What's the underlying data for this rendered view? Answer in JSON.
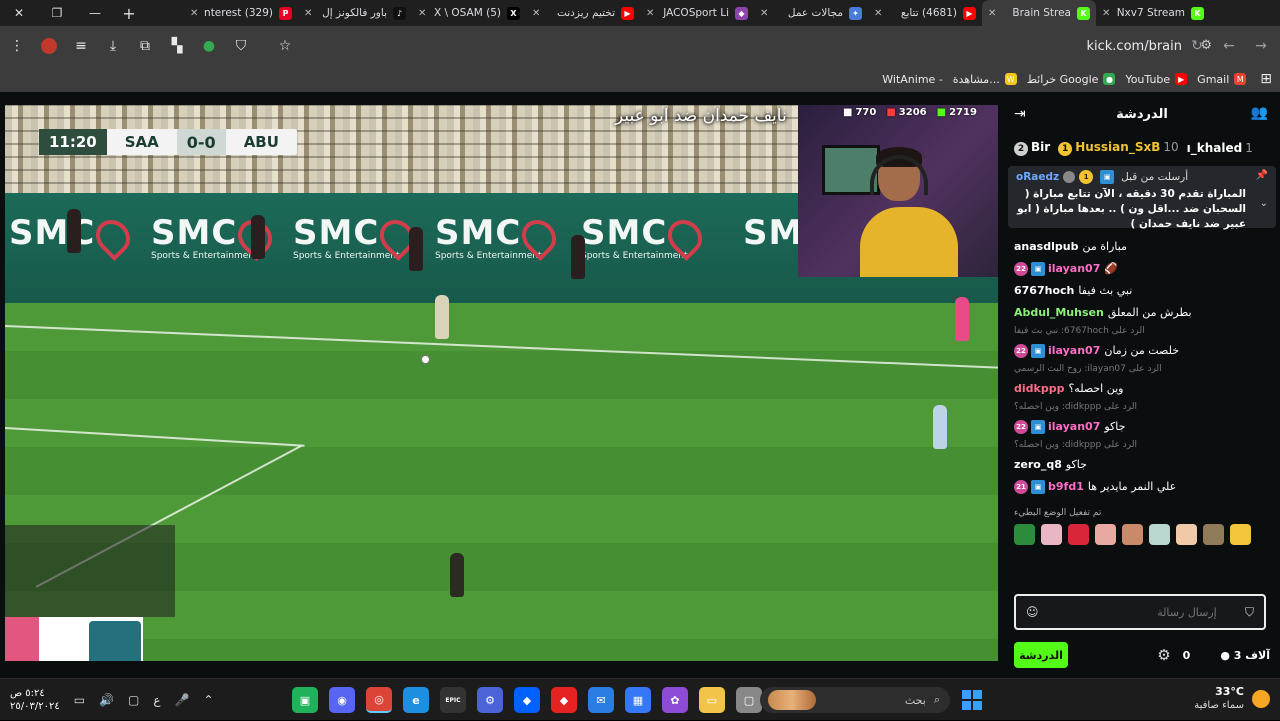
{
  "browser": {
    "window_controls": {
      "close": "✕",
      "restore": "❐",
      "minimize": "—"
    },
    "new_tab_label": "+",
    "tabs": [
      {
        "title": "(329) Pinterest",
        "icon": "pinterest-icon",
        "color": "#e60023",
        "glyph": "P",
        "active": false
      },
      {
        "title": "باور فالكونز إل",
        "icon": "tiktok-icon",
        "color": "#111111",
        "glyph": "♪",
        "active": false
      },
      {
        "title": "(5) X \\ OSAM",
        "icon": "x-icon",
        "color": "#000000",
        "glyph": "X",
        "active": false
      },
      {
        "title": "تختيم ريزدنت",
        "icon": "youtube-icon",
        "color": "#ff0000",
        "glyph": "▶",
        "active": false
      },
      {
        "title": "JACOSport Li",
        "icon": "kick-icon-purple",
        "color": "#8e44ad",
        "glyph": "◆",
        "active": false
      },
      {
        "title": "مجالات عمل",
        "icon": "gemini-icon",
        "color": "#4a7bd9",
        "glyph": "✦",
        "active": false
      },
      {
        "title": "(4681) تتابع",
        "icon": "youtube-icon",
        "color": "#ff0000",
        "glyph": "▶",
        "active": false
      },
      {
        "title": "Brain Strea",
        "icon": "kick-icon",
        "color": "#53fc18",
        "glyph": "K",
        "active": true
      },
      {
        "title": "Nxv7 Stream",
        "icon": "kick-icon",
        "color": "#53fc18",
        "glyph": "K",
        "active": false
      }
    ],
    "address": "kick.com/brain",
    "bookmarks": [
      {
        "label": "Gmail",
        "icon": "gmail-icon",
        "color": "#ea4335",
        "glyph": "M"
      },
      {
        "label": "YouTube",
        "icon": "youtube-icon",
        "color": "#ff0000",
        "glyph": "▶"
      },
      {
        "label": "خرائط Google",
        "icon": "maps-icon",
        "color": "#34a853",
        "glyph": "●"
      },
      {
        "label": "مشاهدة...",
        "icon": "witanime-icon",
        "color": "#f5c518",
        "glyph": "W"
      },
      {
        "label": "WitAnime -",
        "icon": "",
        "color": "",
        "glyph": ""
      }
    ]
  },
  "video": {
    "banner": "نايف حمدان ضد ابو عبير",
    "scoreboard": {
      "time": "11:20",
      "home": "SAA",
      "score": "0-0",
      "away": "ABU"
    },
    "sponsor": "SMC",
    "sponsor_sub": "Sports & Entertainment",
    "counters": [
      {
        "value": "770",
        "icon": "viewer-icon"
      },
      {
        "value": "3206",
        "icon": "youtube-icon"
      },
      {
        "value": "2719",
        "icon": "kick-icon"
      }
    ]
  },
  "chat": {
    "title": "الدردشة",
    "gifters": [
      {
        "name": "Bir",
        "rank": "2",
        "medal_color": "#cfcfcf",
        "count": ""
      },
      {
        "name": "Hussian_SxB",
        "rank": "1",
        "medal_color": "#f1c232",
        "count": "10"
      },
      {
        "name": "ı_khaled",
        "rank": "",
        "medal_color": "",
        "count": "1"
      }
    ],
    "pinned": {
      "user": "oRaedz",
      "label": "أرسلت من قبل",
      "text": "المباراة تقدم 30 دقيقه ، الآن تتابع مباراة ( السحبان ضد ...اقل ون ) .. بعدها مباراة ( ابو عبير ضد نايف حمدان )"
    },
    "messages": [
      {
        "user": "anasdlpub",
        "color": "#ffffff",
        "text": "مباراة من",
        "badges": []
      },
      {
        "user": "ilayan07",
        "color": "#ff6ec7",
        "text": "🏈",
        "badges": [
          "22"
        ]
      },
      {
        "user": "6767hoch",
        "color": "#ffffff",
        "text": "نبي بث فيفا",
        "badges": []
      },
      {
        "user": "Abdul_Muhsen",
        "color": "#8df07a",
        "text": "بطرش من المعلق",
        "badges": []
      },
      {
        "reply": "الرد على 6767hoch: نبي بث فيفا"
      },
      {
        "user": "ilayan07",
        "color": "#ff6ec7",
        "text": "خلصت من زمان",
        "badges": [
          "22"
        ]
      },
      {
        "reply": "الرد على ilayan07: روح البث الرسمي"
      },
      {
        "user": "didkppp",
        "color": "#ff6b8a",
        "text": "وين احصله؟",
        "badges": []
      },
      {
        "reply": "الرد على didkppp: وين احصله؟"
      },
      {
        "user": "ilayan07",
        "color": "#ff6ec7",
        "text": "جاكو",
        "badges": [
          "22"
        ]
      },
      {
        "reply": "الرد على didkppp: وين احصله؟"
      },
      {
        "user": "zero_q8",
        "color": "#ffffff",
        "text": "جاكو",
        "badges": []
      },
      {
        "user": "b9fd1",
        "color": "#ff6ec7",
        "text": "علي النمر مايدير ها",
        "badges": [
          "21"
        ]
      }
    ],
    "emote_note": "تم تفعيل الوضع البطيء",
    "emote_colors": [
      "#2d8c3c",
      "#e9b7c4",
      "#d9263a",
      "#e7a9a0",
      "#c98a6a",
      "#b9d6cf",
      "#f0c9a8",
      "#8f7a5a",
      "#f3c53a"
    ],
    "input_placeholder": "إرسال رسالة",
    "followers": "0",
    "viewers": "3 آلاف",
    "send_label": "الدردشة"
  },
  "taskbar": {
    "temperature": "33°C",
    "weather_text": "سماء صافية",
    "search_label": "بحث",
    "time": "٥:٢٤ ص",
    "date": "٢٥/٠٣/٢٠٢٤",
    "lang": "ع",
    "apps": [
      {
        "name": "task-view-app",
        "color": "#1fb25a",
        "glyph": "▣"
      },
      {
        "name": "discord-app",
        "color": "#5865f2",
        "glyph": "◉"
      },
      {
        "name": "chrome-app",
        "color": "#db4437",
        "glyph": "◎"
      },
      {
        "name": "edge-app",
        "color": "#1d8fe0",
        "glyph": "e"
      },
      {
        "name": "epic-games-app",
        "color": "#333333",
        "glyph": "EPIC"
      },
      {
        "name": "settings-app",
        "color": "#4b63d6",
        "glyph": "⚙"
      },
      {
        "name": "dropbox-app",
        "color": "#0061ff",
        "glyph": "◆"
      },
      {
        "name": "red-app",
        "color": "#e62222",
        "glyph": "◆"
      },
      {
        "name": "mail-app",
        "color": "#2a7de1",
        "glyph": "✉"
      },
      {
        "name": "store-app",
        "color": "#3478f6",
        "glyph": "▦"
      },
      {
        "name": "copilot-app",
        "color": "#8e4bd6",
        "glyph": "✿"
      },
      {
        "name": "explorer-app",
        "color": "#f2c54a",
        "glyph": "▭"
      },
      {
        "name": "window-app",
        "color": "#888888",
        "glyph": "▢"
      }
    ]
  }
}
